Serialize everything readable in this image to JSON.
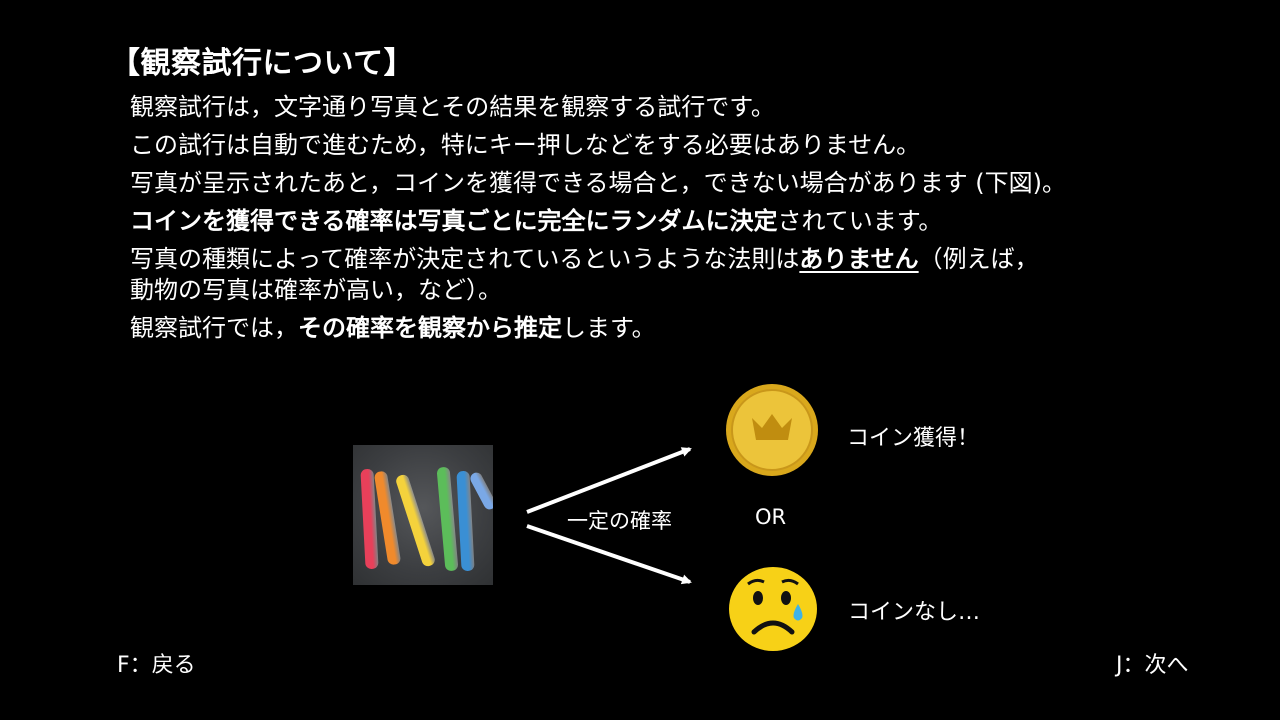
{
  "title": "【観察試行について】",
  "paragraphs": {
    "p1": "観察試行は，文字通り写真とその結果を観察する試行です。",
    "p2": "この試行は自動で進むため，特にキー押しなどをする必要はありません。",
    "p3": "写真が呈示されたあと，コインを獲得できる場合と，できない場合があります (下図)。",
    "p4_bold": "コインを獲得できる確率は写真ごとに完全にランダムに決定",
    "p4_rest": "されています。",
    "p5_pre": "写真の種類によって確率が決定されているというような法則は",
    "p5_bold": "ありません",
    "p5_post": "（例えば，",
    "p5_line2": "動物の写真は確率が高い，など）。",
    "p6_pre": "観察試行では，",
    "p6_bold": "その確率を観察から推定",
    "p6_post": "します。"
  },
  "diagram": {
    "probability_label": "一定の確率",
    "or_label": "OR",
    "coin_label": "コイン獲得！",
    "no_coin_label": "コインなし…",
    "coin_color": "#e8b923",
    "sad_face_color": "#f7d117",
    "chalk_colors": [
      "#e8405a",
      "#f08a2c",
      "#f4d23c",
      "#5cbd5a",
      "#3a8fd4",
      "#7aa8e6"
    ]
  },
  "footer": {
    "back": "F：戻る",
    "next": "J：次へ"
  }
}
